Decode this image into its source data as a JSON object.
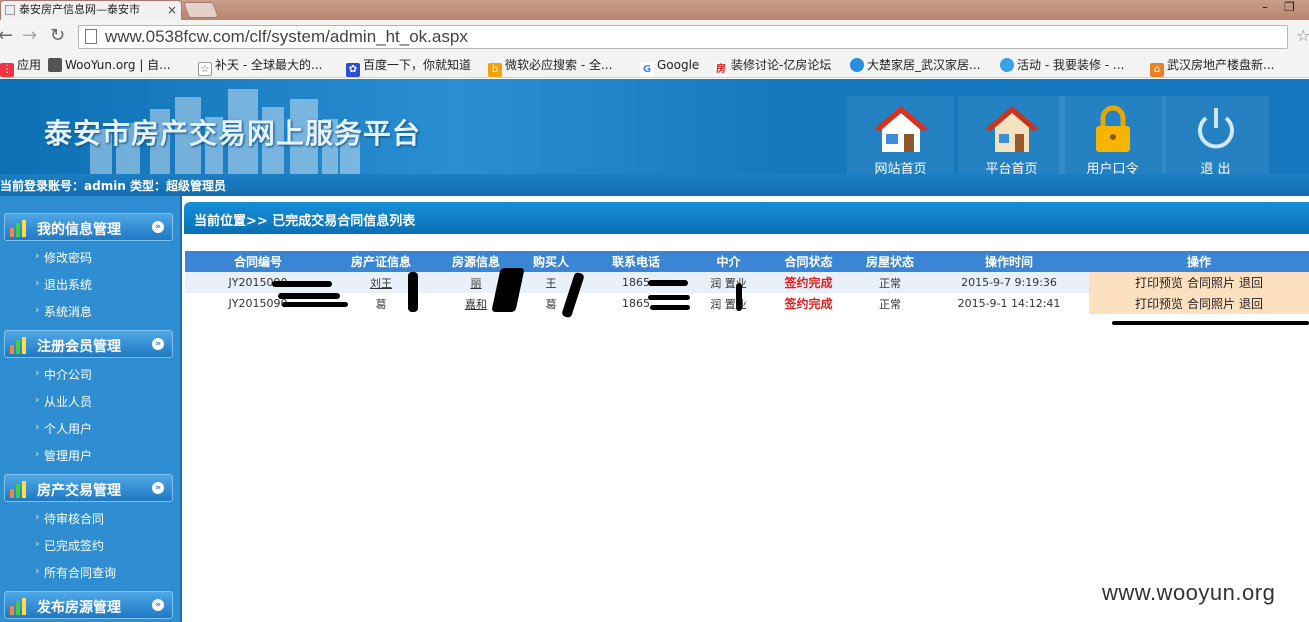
{
  "browser": {
    "tab_title": "泰安房产信息网—泰安市",
    "url": "www.0538fcw.com/clf/system/admin_ht_ok.aspx",
    "bookmarks": [
      "应用",
      "WooYun.org | 自...",
      "补天 - 全球最大的...",
      "百度一下，你就知道",
      "微软必应搜索 - 全...",
      "Google",
      "装修讨论-亿房论坛",
      "大楚家居_武汉家居...",
      "活动 - 我要装修 - ...",
      "武汉房地产楼盘新..."
    ]
  },
  "header": {
    "title": "泰安市房产交易网上服务平台",
    "login_info": "当前登录账号：admin 类型：超级管理员",
    "nav": [
      "网站首页",
      "平台首页",
      "用户口令",
      "退 出"
    ]
  },
  "sidebar": {
    "groups": [
      {
        "label": "我的信息管理",
        "items": [
          "修改密码",
          "退出系统",
          "系统消息"
        ]
      },
      {
        "label": "注册会员管理",
        "items": [
          "中介公司",
          "从业人员",
          "个人用户",
          "管理用户"
        ]
      },
      {
        "label": "房产交易管理",
        "items": [
          "待审核合同",
          "已完成签约",
          "所有合同查询"
        ]
      },
      {
        "label": "发布房源管理",
        "items": []
      }
    ]
  },
  "main": {
    "breadcrumb": "当前位置>> 已完成交易合同信息列表",
    "columns": [
      "合同编号",
      "房产证信息",
      "房源信息",
      "购买人",
      "联系电话",
      "中介",
      "合同状态",
      "房屋状态",
      "操作时间",
      "操作"
    ],
    "rows": [
      {
        "contract_no": "JY2015090",
        "cert": "刘王",
        "house": "丽",
        "buyer": "王",
        "phone": "1865",
        "agency": "润 置业",
        "status": "签约完成",
        "house_status": "正常",
        "time": "2015-9-7 9:19:36",
        "ops": [
          "打印预览",
          "合同照片",
          "退回"
        ]
      },
      {
        "contract_no": "JY2015090",
        "cert": "葛",
        "house": "嘉和",
        "buyer": "葛",
        "phone": "1865",
        "agency": "润 置业",
        "status": "签约完成",
        "house_status": "正常",
        "time": "2015-9-1 14:12:41",
        "ops": [
          "打印预览",
          "合同照片",
          "退回"
        ]
      }
    ]
  },
  "watermark": "www.wooyun.org",
  "colors": {
    "header": "#1578be",
    "status_done": "#e0201e",
    "op_bg": "#fde0c0"
  }
}
